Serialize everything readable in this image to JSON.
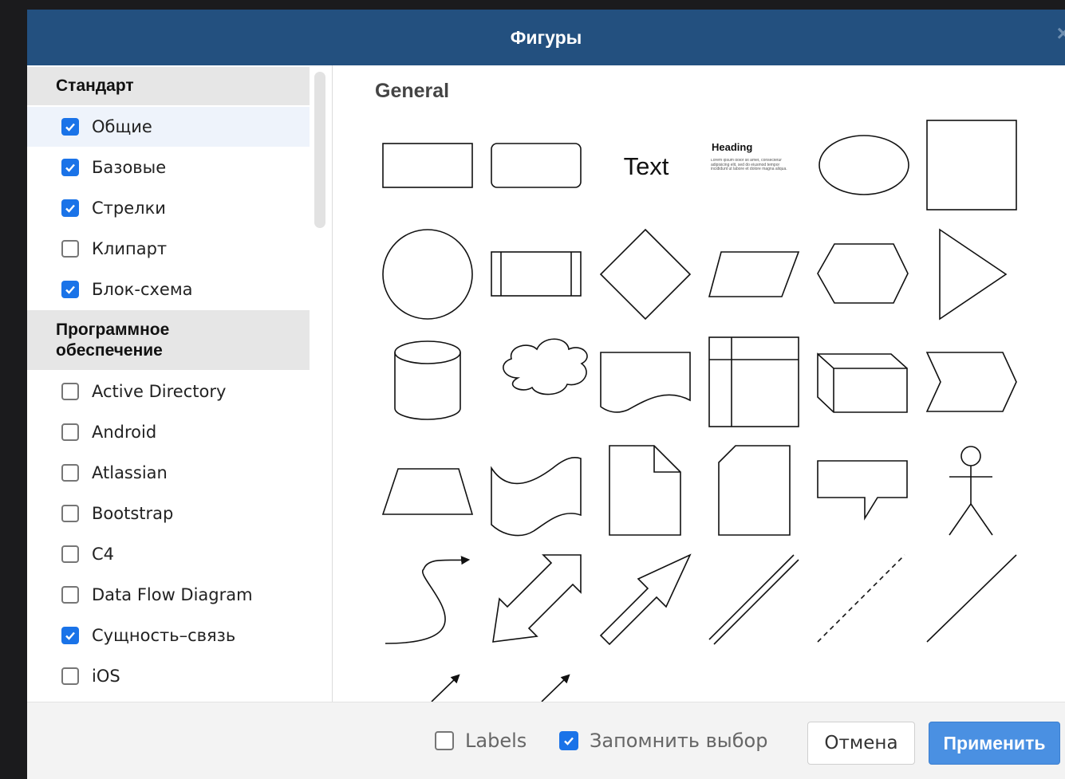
{
  "dialog": {
    "title": "Фигуры",
    "close_icon": "close-icon"
  },
  "sidebar": {
    "groups": [
      {
        "header": "Стандарт",
        "items": [
          {
            "label": "Общие",
            "checked": true,
            "selected": true
          },
          {
            "label": "Базовые",
            "checked": true
          },
          {
            "label": "Стрелки",
            "checked": true
          },
          {
            "label": "Клипарт",
            "checked": false
          },
          {
            "label": "Блок-схема",
            "checked": true
          }
        ]
      },
      {
        "header": "Программное обеспечение",
        "items": [
          {
            "label": "Active Directory",
            "checked": false
          },
          {
            "label": "Android",
            "checked": false
          },
          {
            "label": "Atlassian",
            "checked": false
          },
          {
            "label": "Bootstrap",
            "checked": false
          },
          {
            "label": "C4",
            "checked": false
          },
          {
            "label": "Data Flow Diagram",
            "checked": false
          },
          {
            "label": "Сущность–связь",
            "checked": true
          },
          {
            "label": "iOS",
            "checked": false
          }
        ]
      }
    ]
  },
  "content": {
    "section_title": "General",
    "text_shape_label": "Text",
    "heading_shape": {
      "title": "Heading",
      "body": "Lorem ipsum dolor sit amet, consectetur adipisicing elit, sed do eiusmod tempor incididunt ut labore et dolore magna aliqua."
    }
  },
  "footer": {
    "labels_checkbox": {
      "label": "Labels",
      "checked": false
    },
    "remember_checkbox": {
      "label": "Запомнить выбор",
      "checked": true
    },
    "cancel_label": "Отмена",
    "apply_label": "Применить"
  },
  "colors": {
    "titlebar": "#23507f",
    "apply_button": "#4a90e2",
    "checkbox_on": "#1a73e8"
  }
}
